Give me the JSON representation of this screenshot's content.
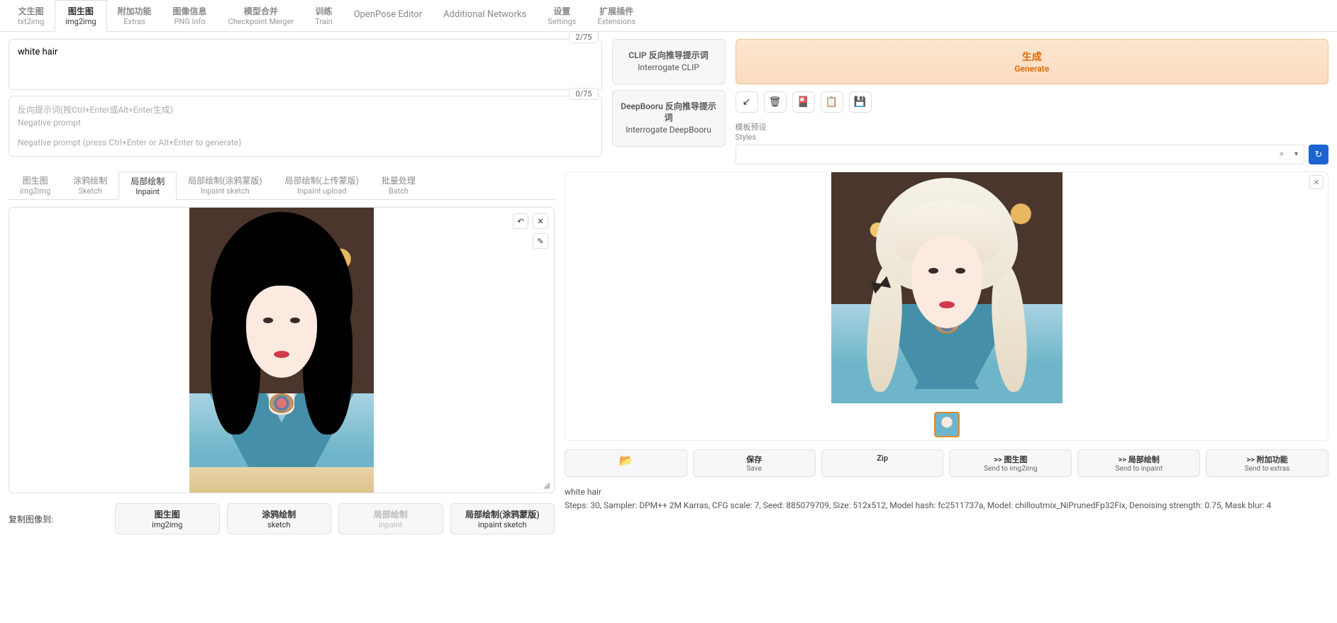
{
  "mainTabs": [
    {
      "cn": "文生图",
      "en": "txt2img"
    },
    {
      "cn": "图生图",
      "en": "img2img"
    },
    {
      "cn": "附加功能",
      "en": "Extras"
    },
    {
      "cn": "图像信息",
      "en": "PNG Info"
    },
    {
      "cn": "模型合并",
      "en": "Checkpoint Merger"
    },
    {
      "cn": "训练",
      "en": "Train"
    },
    {
      "cn": "",
      "en": "OpenPose Editor"
    },
    {
      "cn": "",
      "en": "Additional Networks"
    },
    {
      "cn": "设置",
      "en": "Settings"
    },
    {
      "cn": "扩展插件",
      "en": "Extensions"
    }
  ],
  "mainTabActive": 1,
  "prompt": {
    "value": "white hair",
    "tokens": "2/75"
  },
  "negPrompt": {
    "tokens": "0/75",
    "ph1": "反向提示词(按Ctrl+Enter或Alt+Enter生成)",
    "ph2": "Negative prompt",
    "ph3": "Negative prompt (press Ctrl+Enter or Alt+Enter to generate)"
  },
  "interrogate": {
    "clip_cn": "CLIP 反向推导提示词",
    "clip_en": "Interrogate CLIP",
    "deep_cn": "DeepBooru 反向推导提示词",
    "deep_en": "Interrogate DeepBooru"
  },
  "generate": {
    "cn": "生成",
    "en": "Generate"
  },
  "tools": {
    "t1": "↙",
    "t2": "🗑",
    "t3": "🎴",
    "t4": "📋",
    "t5": "💾"
  },
  "styles": {
    "label_cn": "模板预设",
    "label_en": "Styles",
    "clear": "×",
    "dd": "▾",
    "refresh": "↻"
  },
  "subTabs": [
    {
      "cn": "图生图",
      "en": "img2img"
    },
    {
      "cn": "涂鸦绘制",
      "en": "Sketch"
    },
    {
      "cn": "局部绘制",
      "en": "Inpaint"
    },
    {
      "cn": "局部绘制(涂鸦蒙版)",
      "en": "Inpaint sketch"
    },
    {
      "cn": "局部绘制(上传蒙版)",
      "en": "Inpaint upload"
    },
    {
      "cn": "批量处理",
      "en": "Batch"
    }
  ],
  "subTabActive": 2,
  "canvasTools": {
    "undo": "↶",
    "close": "✕",
    "pen": "✎"
  },
  "copyLabel": "复制图像到:",
  "copyBtns": [
    {
      "cn": "图生图",
      "en": "img2img",
      "disabled": false
    },
    {
      "cn": "涂鸦绘制",
      "en": "sketch",
      "disabled": false
    },
    {
      "cn": "局部绘制",
      "en": "inpaint",
      "disabled": true
    },
    {
      "cn": "局部绘制(涂鸦蒙版)",
      "en": "inpaint sketch",
      "disabled": false
    }
  ],
  "outputClose": "✕",
  "actions": {
    "folder": "📂",
    "save": {
      "cn": "保存",
      "en": "Save"
    },
    "zip": "Zip",
    "toImg": {
      "cn": ">> 图生图",
      "en": "Send to img2img"
    },
    "toInpaint": {
      "cn": ">> 局部绘制",
      "en": "Send to inpaint"
    },
    "toExtras": {
      "cn": ">> 附加功能",
      "en": "Send to extras"
    }
  },
  "info": {
    "prompt": "white hair",
    "params": "Steps: 30, Sampler: DPM++ 2M Karras, CFG scale: 7, Seed: 885079709, Size: 512x512, Model hash: fc2511737a, Model: chilloutmix_NiPrunedFp32Fix, Denoising strength: 0.75, Mask blur: 4"
  }
}
